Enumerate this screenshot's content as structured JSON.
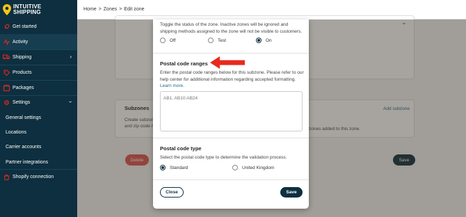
{
  "brand": {
    "line1": "INTUITIVE",
    "line2": "SHIPPING"
  },
  "sidebar": {
    "items": [
      {
        "label": "Get started",
        "icon": "rocket-icon"
      },
      {
        "label": "Activity",
        "icon": "activity-icon"
      },
      {
        "label": "Shipping",
        "icon": "truck-icon"
      },
      {
        "label": "Products",
        "icon": "tag-icon"
      },
      {
        "label": "Packages",
        "icon": "box-icon"
      },
      {
        "label": "Settings",
        "icon": "gear-icon"
      }
    ],
    "settings_sub": [
      {
        "label": "General settings"
      },
      {
        "label": "Locations"
      },
      {
        "label": "Carrier accounts"
      },
      {
        "label": "Partner integrations"
      }
    ],
    "shopify": {
      "label": "Shopify connection",
      "icon": "shopify-icon"
    }
  },
  "breadcrumb": {
    "home": "Home",
    "sep": ">",
    "zones": "Zones",
    "edit": "Edit zone"
  },
  "background": {
    "subzones_title": "Subzones",
    "subzones_desc_1": "Create subzone",
    "subzones_desc_2": "and zip code ra",
    "add_subzone": "Add subzone",
    "empty_msg": "zones added to this zone.",
    "delete": "Delete",
    "save": "Save"
  },
  "modal": {
    "status_desc": "Toggle the status of the zone. Inactive zones will be ignored and shipping methods assigned to the zone will not be visible to customers.",
    "status_options": [
      {
        "label": "Off",
        "selected": false
      },
      {
        "label": "Test",
        "selected": false
      },
      {
        "label": "On",
        "selected": true
      }
    ],
    "postal_ranges_title": "Postal code ranges",
    "postal_ranges_desc": "Enter the postal code ranges below for this subzone. Please refer to our help center for additional information regarding accepted formatting.",
    "learn_more": "Learn more.",
    "postal_placeholder": "AB1, AB10:AB24",
    "postal_type_title": "Postal code type",
    "postal_type_desc": "Select the postal code type to determine the validation process.",
    "type_options": [
      {
        "label": "Standard",
        "selected": true
      },
      {
        "label": "United Kingdom",
        "selected": false
      }
    ],
    "close": "Close",
    "save": "Save"
  },
  "colors": {
    "sidebar": "#0d2f3f",
    "accent": "#0d2f3f",
    "arrow": "#e8291c",
    "danger": "#d9534f",
    "link": "#1a6c8a"
  }
}
